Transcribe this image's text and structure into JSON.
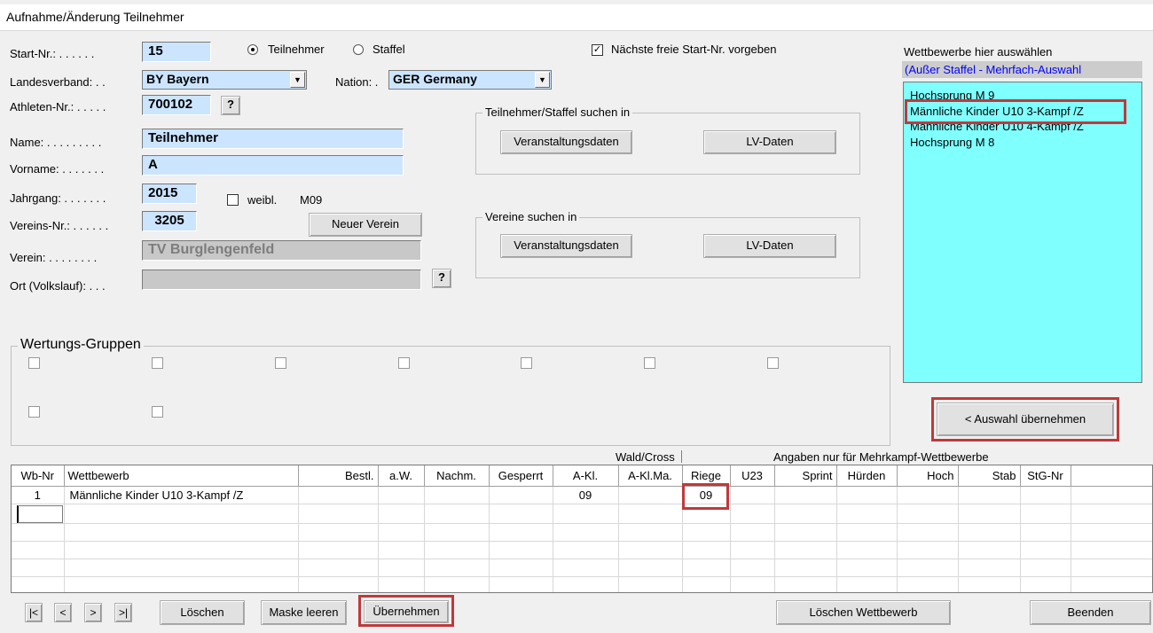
{
  "window": {
    "title": "Aufnahme/Änderung Teilnehmer"
  },
  "labels": {
    "start_nr": "Start-Nr.: . . . . . .",
    "landesverband": "Landesverband: . .",
    "nation": "Nation: .",
    "athleten_nr": "Athleten-Nr.: . . . . .",
    "name": "Name: . . . . . . . . .",
    "vorname": "Vorname: . . . . . . .",
    "jahrgang": "Jahrgang: . . . . . . .",
    "vereins_nr": "Vereins-Nr.: . . . . . .",
    "verein": "Verein: . . . . . . . .",
    "ort": "Ort (Volkslauf): . . ."
  },
  "fields": {
    "start_nr": "15",
    "landesverband": "BY Bayern",
    "nation": "GER  Germany",
    "athleten_nr": "700102",
    "name": "Teilnehmer",
    "vorname": "A",
    "jahrgang": "2015",
    "vereins_nr": "3205",
    "verein": "TV Burglengenfeld",
    "ort": ""
  },
  "radios": {
    "teilnehmer": "Teilnehmer",
    "staffel": "Staffel"
  },
  "checkboxes": {
    "naechste": "Nächste freie Start-Nr. vorgeben",
    "weibl": "weibl."
  },
  "age_class": "M09",
  "help_label": "?",
  "buttons": {
    "neuer_verein": "Neuer Verein",
    "veranstaltungsdaten": "Veranstaltungsdaten",
    "lv_daten": "LV-Daten",
    "auswahl": "< Auswahl übernehmen",
    "loeschen": "Löschen",
    "maske_leeren": "Maske leeren",
    "uebernehmen": "Übernehmen",
    "loeschen_wettbewerb": "Löschen Wettbewerb",
    "beenden": "Beenden"
  },
  "nav_buttons": [
    "|<",
    "<",
    ">",
    ">|"
  ],
  "groups": {
    "teilnehmer_suchen": "Teilnehmer/Staffel suchen in",
    "vereine_suchen": "Vereine suchen in",
    "wertungs_gruppen": "Wertungs-Gruppen"
  },
  "wettbewerbe": {
    "header": "Wettbewerbe hier auswählen",
    "note": "(Außer Staffel - Mehrfach-Auswahl",
    "items": [
      "Hochsprung M 9",
      "Männliche Kinder U10  3-Kampf /Z",
      "Männliche Kinder U10  4-Kampf /Z",
      "Hochsprung M 8"
    ]
  },
  "table": {
    "group_headers": {
      "wald": "Wald/Cross",
      "mehrkampf": "Angaben nur für Mehrkampf-Wettbewerbe"
    },
    "columns": [
      "Wb-Nr",
      "Wettbewerb",
      "Bestl.",
      "a.W.",
      "Nachm.",
      "Gesperrt",
      "A-Kl.",
      "A-Kl.Ma.",
      "Riege",
      "U23",
      "Sprint",
      "Hürden",
      "Hoch",
      "Stab",
      "StG-Nr"
    ],
    "rows": [
      [
        "1",
        "Männliche Kinder U10  3-Kampf /Z",
        "",
        "",
        "",
        "",
        "09",
        "",
        "09",
        "",
        "",
        "",
        "",
        "",
        ""
      ]
    ]
  },
  "colors": {
    "field_bg": "#cce5ff",
    "list_bg": "#80ffff",
    "highlight": "#c0393b",
    "note_color": "#0000ff"
  }
}
